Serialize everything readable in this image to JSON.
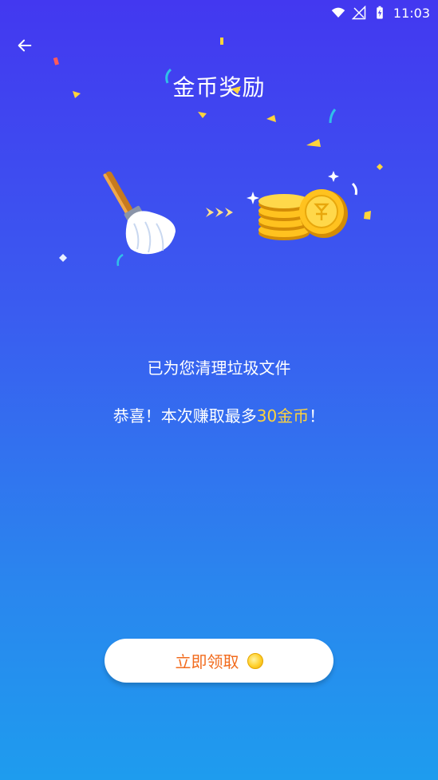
{
  "status_bar": {
    "time": "11:03"
  },
  "header": {
    "title": "金币奖励"
  },
  "messages": {
    "line1": "已为您清理垃圾文件",
    "line2_prefix": "恭喜！本次赚取最多",
    "line2_amount": "30金币",
    "line2_suffix": "！"
  },
  "claim_button": {
    "label": "立即领取"
  },
  "colors": {
    "highlight": "#ffd43b",
    "button_text": "#f26b1d",
    "background_top": "#4338f0",
    "background_bottom": "#1e9cee"
  }
}
